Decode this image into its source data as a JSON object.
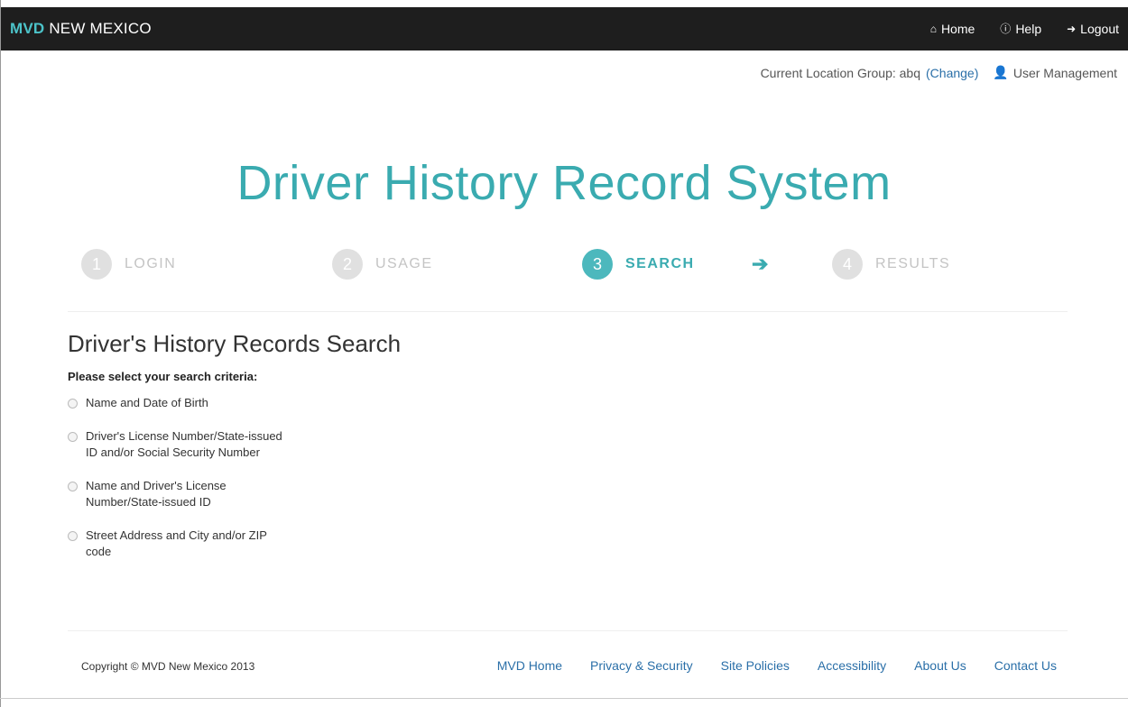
{
  "navbar": {
    "brand_mvd": "MVD",
    "brand_rest": " NEW MEXICO",
    "links": [
      {
        "label": "Home",
        "icon": "home-icon"
      },
      {
        "label": "Help",
        "icon": "info-icon"
      },
      {
        "label": "Logout",
        "icon": "logout-icon"
      }
    ]
  },
  "location": {
    "prefix": "Current Location Group: abq",
    "change_label": "(Change)",
    "user_management": "User Management"
  },
  "title": "Driver History Record System",
  "steps": [
    {
      "num": "1",
      "label": "LOGIN",
      "active": false
    },
    {
      "num": "2",
      "label": "USAGE",
      "active": false
    },
    {
      "num": "3",
      "label": "SEARCH",
      "active": true
    },
    {
      "num": "4",
      "label": "RESULTS",
      "active": false
    }
  ],
  "search": {
    "heading": "Driver's History Records Search",
    "criteria_label": "Please select your search criteria:",
    "options": [
      "Name and Date of Birth",
      "Driver's License Number/State-issued ID and/or Social Security Number",
      "Name and Driver's License Number/State-issued ID",
      "Street Address and City and/or ZIP code"
    ]
  },
  "footer": {
    "copyright": "Copyright © MVD New Mexico 2013",
    "links": [
      "MVD Home",
      "Privacy & Security",
      "Site Policies",
      "Accessibility",
      "About Us",
      "Contact Us"
    ]
  },
  "colors": {
    "accent": "#3aabb0",
    "link": "#2a6fa8",
    "navbar": "#1e1e1e"
  }
}
